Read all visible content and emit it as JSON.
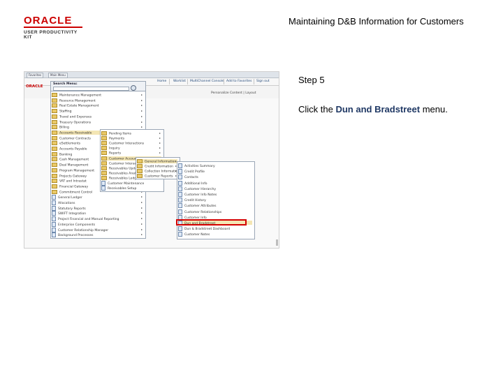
{
  "logo": {
    "brand": "ORACLE",
    "product": "USER PRODUCTIVITY KIT"
  },
  "header": {
    "title": "Maintaining D&B Information for Customers"
  },
  "step": {
    "label": "Step 5"
  },
  "instruction": {
    "prefix": "Click the ",
    "emphasis": "Dun and Bradstreet",
    "suffix": " menu."
  },
  "screenshot": {
    "tabs": [
      "Favorites",
      "Main Menu"
    ],
    "brand": "ORACLE",
    "nav_links": [
      "Home",
      "Worklist",
      "MultiChannel Console",
      "Add to Favorites",
      "Sign out"
    ],
    "personalize": "Personalize Content | Layout",
    "search_label": "Search Menu:",
    "level1": [
      "Maintenance Management",
      "Resource Management",
      "Real Estate Management",
      "Staffing",
      "Travel and Expenses",
      "Treasury Operations",
      "Billing",
      "Accounts Receivable",
      "Customer Contracts",
      "eSettlements",
      "Accounts Payable",
      "Banking",
      "Cash Management",
      "Deal Management",
      "Program Management",
      "Projects Gateway",
      "VAT and Intrastat",
      "Financial Gateway",
      "Commitment Control",
      "General Ledger",
      "Allocations",
      "Statutory Reports",
      "SWIFT Integration",
      "Project Financial and Manual Reporting",
      "Enterprise Components",
      "Customer Relationship Manager",
      "Background Processes"
    ],
    "level2": [
      "Pending Items",
      "Payments",
      "Customer Interactions",
      "Inquiry",
      "Reports",
      "Customer Accounts",
      "Customer Interactions",
      "Receivables Update",
      "Receivables Analysis",
      "Receivables Ledger",
      "Customer Maintenance",
      "Receivables Setup"
    ],
    "level3": [
      "General Information",
      "Credit Information",
      "Collection Information",
      "Customer Reports"
    ],
    "level4": [
      "Activities Summary",
      "Credit Profile",
      "Contacts",
      "Additional Info",
      "Customer Hierarchy",
      "Customer Info Notes",
      "Credit History",
      "Customer Attributes",
      "Customer Relationships",
      "Customer Info",
      "Dun and Bradstreet",
      "Dun & Bradstreet Dashboard",
      "Customer Notes"
    ]
  }
}
